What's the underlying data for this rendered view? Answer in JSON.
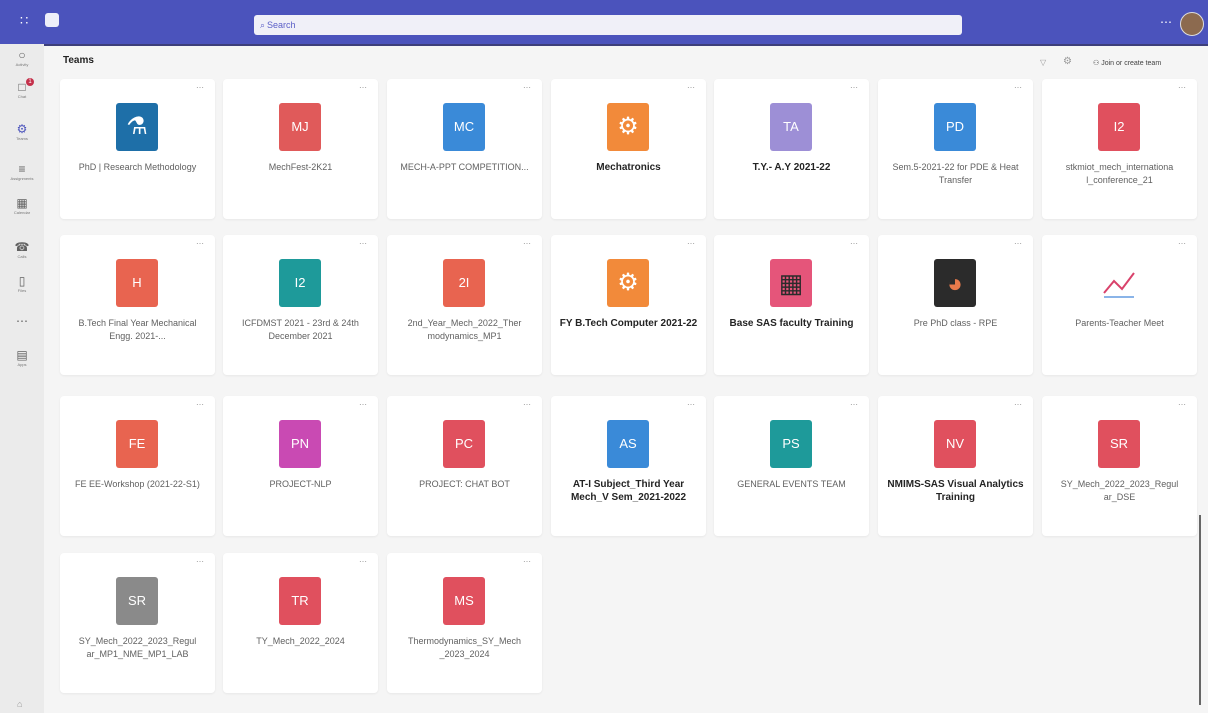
{
  "header": {
    "search_placeholder": "Search"
  },
  "rail": [
    {
      "icon": "bell-icon",
      "label": "Activity",
      "badge": ""
    },
    {
      "icon": "chat-icon",
      "label": "Chat",
      "badge": "1"
    },
    {
      "icon": "teams-icon",
      "label": "Teams",
      "badge": ""
    },
    {
      "icon": "assignments-icon",
      "label": "Assignments",
      "badge": ""
    },
    {
      "icon": "calendar-icon",
      "label": "Calendar",
      "badge": ""
    },
    {
      "icon": "calls-icon",
      "label": "Calls",
      "badge": ""
    },
    {
      "icon": "files-icon",
      "label": "Files",
      "badge": ""
    },
    {
      "icon": "more-icon",
      "label": "",
      "badge": ""
    },
    {
      "icon": "apps-icon",
      "label": "Apps",
      "badge": ""
    }
  ],
  "page": {
    "title": "Teams",
    "join_label": "Join or create team"
  },
  "cards": [
    {
      "initials": "",
      "icon": "microscope-icon",
      "color": "#1e6fa8",
      "name": "PhD | Research Methodology",
      "bold": false
    },
    {
      "initials": "MJ",
      "icon": "",
      "color": "#e05a5a",
      "name": "MechFest-2K21",
      "bold": false
    },
    {
      "initials": "MC",
      "icon": "",
      "color": "#3a8ad8",
      "name": "MECH-A-PPT COMPETITION...",
      "bold": false
    },
    {
      "initials": "",
      "icon": "gears-icon",
      "color": "#f28a3a",
      "name": "Mechatronics",
      "bold": true
    },
    {
      "initials": "TA",
      "icon": "",
      "color": "#9d8fd6",
      "name": "T.Y.- A.Y 2021-22",
      "bold": true
    },
    {
      "initials": "PD",
      "icon": "",
      "color": "#3a8ad8",
      "name": "Sem.5-2021-22 for PDE & Heat Transfer",
      "bold": false
    },
    {
      "initials": "I2",
      "icon": "",
      "color": "#e0505e",
      "name": "stkmiot_mech_internationa l_conference_21",
      "bold": false
    },
    {
      "initials": "H",
      "icon": "",
      "color": "#e86450",
      "name": "B.Tech Final Year Mechanical Engg. 2021-...",
      "bold": false
    },
    {
      "initials": "I2",
      "icon": "",
      "color": "#1e9a9a",
      "name": "ICFDMST 2021 - 23rd & 24th December 2021",
      "bold": false
    },
    {
      "initials": "2I",
      "icon": "",
      "color": "#e86450",
      "name": "2nd_Year_Mech_2022_Ther modynamics_MP1",
      "bold": false
    },
    {
      "initials": "",
      "icon": "gears-icon",
      "color": "#f28a3a",
      "name": "FY B.Tech Computer 2021-22",
      "bold": true
    },
    {
      "initials": "",
      "icon": "calculator-icon",
      "color": "#e5557a",
      "name": "Base SAS faculty Training",
      "bold": true
    },
    {
      "initials": "",
      "icon": "pie-chart-icon",
      "color": "#2b2b2b",
      "name": "Pre PhD class - RPE",
      "bold": false
    },
    {
      "initials": "",
      "icon": "trend-icon",
      "color": "#ffffff",
      "name": "Parents-Teacher Meet",
      "bold": false
    },
    {
      "initials": "FE",
      "icon": "",
      "color": "#e86450",
      "name": "FE EE-Workshop (2021-22-S1)",
      "bold": false
    },
    {
      "initials": "PN",
      "icon": "",
      "color": "#c94ab3",
      "name": "PROJECT-NLP",
      "bold": false
    },
    {
      "initials": "PC",
      "icon": "",
      "color": "#e0505e",
      "name": "PROJECT: CHAT BOT",
      "bold": false
    },
    {
      "initials": "AS",
      "icon": "",
      "color": "#3a8ad8",
      "name": "AT-I Subject_Third Year Mech_V Sem_2021-2022",
      "bold": true
    },
    {
      "initials": "PS",
      "icon": "",
      "color": "#1e9a9a",
      "name": "GENERAL EVENTS TEAM",
      "bold": false
    },
    {
      "initials": "NV",
      "icon": "",
      "color": "#e0505e",
      "name": "NMIMS-SAS Visual Analytics Training",
      "bold": true
    },
    {
      "initials": "SR",
      "icon": "",
      "color": "#e0505e",
      "name": "SY_Mech_2022_2023_Regul ar_DSE",
      "bold": false
    },
    {
      "initials": "SR",
      "icon": "",
      "color": "#8a8a8a",
      "name": "SY_Mech_2022_2023_Regul ar_MP1_NME_MP1_LAB",
      "bold": false
    },
    {
      "initials": "TR",
      "icon": "",
      "color": "#e0505e",
      "name": "TY_Mech_2022_2024",
      "bold": false
    },
    {
      "initials": "MS",
      "icon": "",
      "color": "#e0505e",
      "name": "Thermodynamics_SY_Mech _2023_2024",
      "bold": false
    }
  ]
}
